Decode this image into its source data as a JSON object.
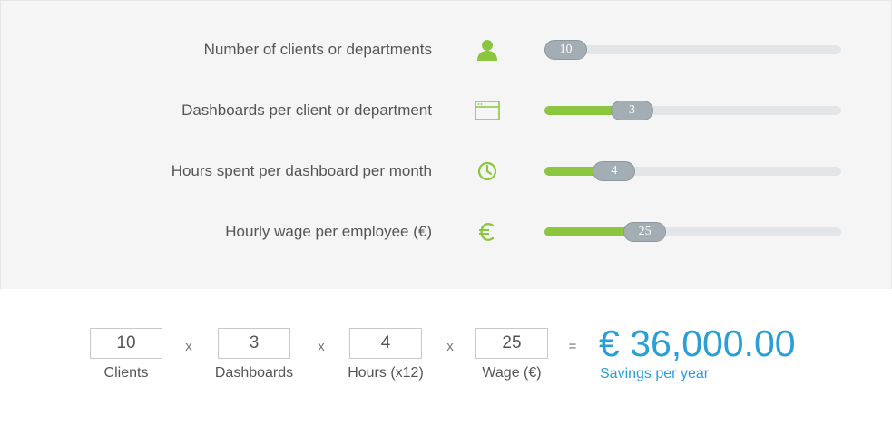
{
  "colors": {
    "accent_green": "#8cc63f",
    "accent_blue": "#2a9fd6",
    "track": "#e2e6e9",
    "handle": "#a3adb4"
  },
  "sliders": [
    {
      "label": "Number of clients or departments",
      "icon": "user-icon",
      "value": "10",
      "fill_fraction": 0.0
    },
    {
      "label": "Dashboards per client or department",
      "icon": "browser-window-icon",
      "value": "3",
      "fill_fraction": 0.26
    },
    {
      "label": "Hours spent per dashboard per month",
      "icon": "clock-icon",
      "value": "4",
      "fill_fraction": 0.19
    },
    {
      "label": "Hourly wage per employee (€)",
      "icon": "euro-icon",
      "value": "25",
      "fill_fraction": 0.31
    }
  ],
  "formula": {
    "clients": {
      "value": "10",
      "label": "Clients"
    },
    "dashboards": {
      "value": "3",
      "label": "Dashboards"
    },
    "hours": {
      "value": "4",
      "label": "Hours (x12)"
    },
    "wage": {
      "value": "25",
      "label": "Wage (€)"
    },
    "op_multiply": "x",
    "op_equals": "=",
    "total": "€ 36,000.00",
    "total_label": "Savings per year"
  }
}
